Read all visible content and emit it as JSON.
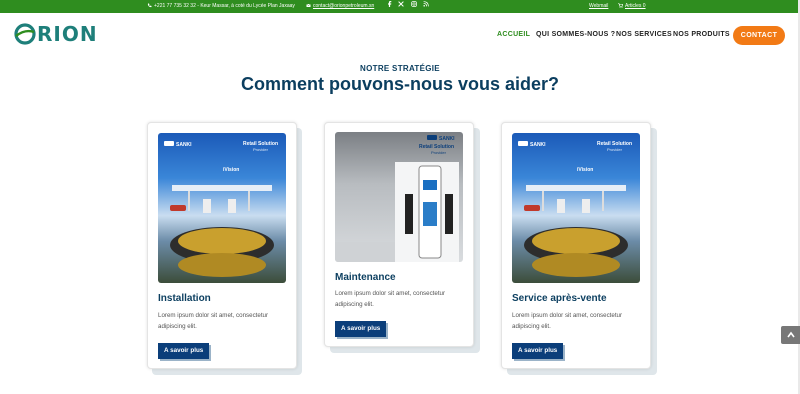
{
  "topbar": {
    "phone": "+221 77 735 32 32",
    "address": "Keur Massar, à coté du Lycée Plan Jaxaay",
    "email": "contact@orionpetroleum.sn",
    "webmail": "Webmail",
    "cart": "Articles 0",
    "social_icons": [
      "facebook-icon",
      "x-icon",
      "instagram-icon",
      "rss-icon"
    ]
  },
  "header": {
    "logo": "RION",
    "nav": [
      "ACCUEIL",
      "QUI SOMMES-NOUS ?",
      "NOS SERVICES",
      "NOS PRODUITS"
    ],
    "active_nav": "ACCUEIL",
    "contact_button": "CONTACT"
  },
  "section": {
    "eyebrow": "NOTRE STRATÉGIE",
    "title": "Comment pouvons-nous vous aider?"
  },
  "cards": [
    {
      "title": "Installation",
      "text_line1": "Lorem ipsum dolor sit amet, consectetur",
      "text_line2": "adipiscing elit.",
      "button": "A savoir plus",
      "image": {
        "brand": "SANKI",
        "headline": "Retail Solution",
        "sub": "Provider",
        "tag": "iVision"
      }
    },
    {
      "title": "Maintenance",
      "text_line1": "Lorem ipsum dolor sit amet, consectetur",
      "text_line2": "adipiscing elit.",
      "button": "A savoir plus",
      "image": {
        "brand": "SANKI",
        "headline": "Retail Solution",
        "sub": "Provider"
      }
    },
    {
      "title": "Service après-vente",
      "text_line1": "Lorem ipsum dolor sit amet, consectetur",
      "text_line2": "adipiscing elit.",
      "button": "A savoir plus",
      "image": {
        "brand": "SANKI",
        "headline": "Retail Solution",
        "sub": "Provider",
        "tag": "iVision"
      }
    }
  ],
  "colors": {
    "green": "#2f8d1f",
    "navy": "#0b3e5f",
    "orange": "#f27a15",
    "button": "#0b3e7a"
  }
}
